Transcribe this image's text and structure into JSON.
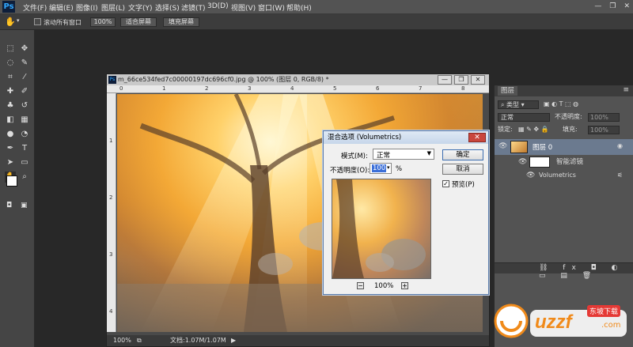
{
  "app": {
    "logo": "Ps"
  },
  "menus": [
    "文件(F)",
    "编辑(E)",
    "图像(I)",
    "图层(L)",
    "文字(Y)",
    "选择(S)",
    "滤镜(T)",
    "3D(D)",
    "视图(V)",
    "窗口(W)",
    "帮助(H)"
  ],
  "options": {
    "scroll_all": "滚动所有窗口",
    "zoom_100": "100%",
    "fit_screen": "适合屏幕",
    "fill_screen": "填充屏幕"
  },
  "document": {
    "title": "m_66ce534fed7c00000197dc696cf0.jpg @ 100% (图层 0, RGB/8) *",
    "zoom": "100%",
    "doc_size": "文档:1.07M/1.07M",
    "ruler_top": [
      "0",
      "1",
      "2",
      "3",
      "4",
      "5",
      "6",
      "7",
      "8"
    ],
    "ruler_left": [
      "1",
      "2",
      "3",
      "4"
    ]
  },
  "dialog": {
    "title": "混合选项 (Volumetrics)",
    "mode_label": "模式(M):",
    "mode_value": "正常",
    "opacity_label": "不透明度(O):",
    "opacity_value": "100",
    "opacity_unit": "%",
    "ok": "确定",
    "cancel": "取消",
    "preview_label": "预览(P)",
    "zoom": "100%",
    "minus": "−",
    "plus": "+"
  },
  "layers": {
    "tab": "图层",
    "filter_kind": "类型",
    "blend": "正常",
    "opacity_label": "不透明度:",
    "opacity_value": "100%",
    "lock_label": "锁定:",
    "fill_label": "填充:",
    "fill_value": "100%",
    "layer0": "图层 0",
    "smart_filter": "智能滤镜",
    "filter_name": "Volumetrics"
  },
  "watermark": {
    "brand": "uzzf",
    "sub": "东坡下载",
    "dot": ".com"
  },
  "colors": {
    "accent": "#31a8ff",
    "dialog_border": "#5a7aa8",
    "close_red": "#c9463d"
  }
}
